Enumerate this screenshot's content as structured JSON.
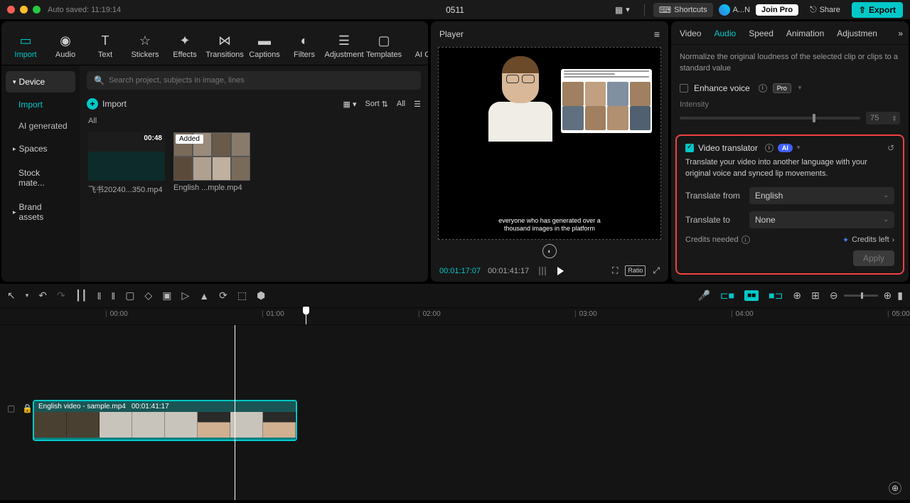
{
  "titlebar": {
    "autosave": "Auto saved: 11:19:14",
    "title": "0511",
    "shortcuts": "Shortcuts",
    "user": "A...N",
    "join_pro": "Join Pro",
    "share": "Share",
    "export": "Export"
  },
  "tools": {
    "import": "Import",
    "audio": "Audio",
    "text": "Text",
    "stickers": "Stickers",
    "effects": "Effects",
    "transitions": "Transitions",
    "captions": "Captions",
    "filters": "Filters",
    "adjustment": "Adjustment",
    "templates": "Templates",
    "aici": "AI CI"
  },
  "sidebar": {
    "device": "Device",
    "import": "Import",
    "ai": "AI generated",
    "spaces": "Spaces",
    "stock": "Stock mate...",
    "brand": "Brand assets"
  },
  "media": {
    "search_placeholder": "Search project, subjects in image, lines",
    "import_btn": "Import",
    "sort": "Sort",
    "all": "All",
    "all_hdr": "All",
    "thumb1": {
      "dur": "00:48",
      "name": "飞书20240...350.mp4"
    },
    "thumb2": {
      "added": "Added",
      "name": "English ...mple.mp4"
    }
  },
  "player": {
    "title": "Player",
    "caption1": "everyone who has generated over a",
    "caption2": "thousand images in the platform",
    "current": "00:01:17:07",
    "total": "00:01:41:17",
    "ratio": "Ratio"
  },
  "inspector": {
    "tabs": {
      "video": "Video",
      "audio": "Audio",
      "speed": "Speed",
      "animation": "Animation",
      "adjustment": "Adjustmen"
    },
    "normalize": "Normalize the original loudness of the selected clip or clips to a standard value",
    "enhance": "Enhance voice",
    "pro": "Pro",
    "intensity": "Intensity",
    "intensity_val": "75",
    "translator": {
      "title": "Video translator",
      "ai": "AI",
      "desc": "Translate your video into another language with your original voice and synced lip movements.",
      "from_lbl": "Translate from",
      "from_val": "English",
      "to_lbl": "Translate to",
      "to_val": "None",
      "credits_needed": "Credits needed",
      "credits_left": "Credits left",
      "apply": "Apply"
    }
  },
  "timeline": {
    "ticks": [
      "00:00",
      "01:00",
      "02:00",
      "03:00",
      "04:00",
      "05:00"
    ],
    "clip_name": "English video - sample.mp4",
    "clip_dur": "00:01:41:17"
  }
}
